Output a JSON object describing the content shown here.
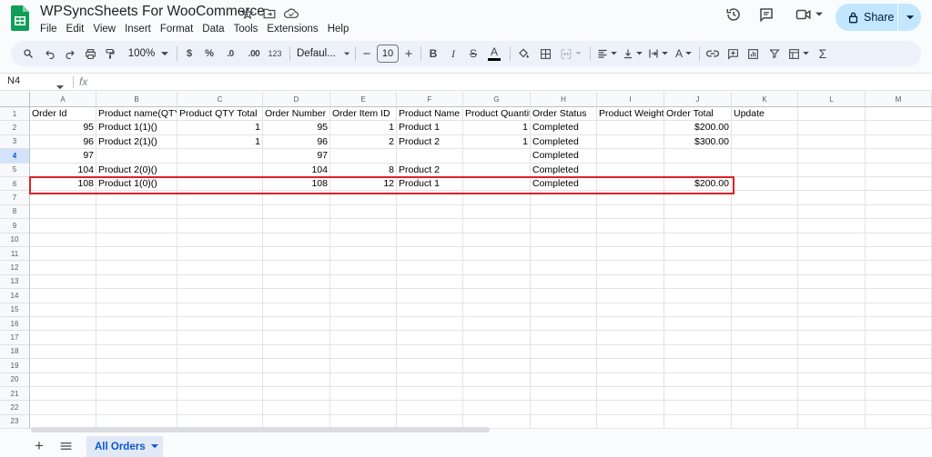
{
  "app": {
    "title": "WPSyncSheets For WooCommerce",
    "menu": [
      "File",
      "Edit",
      "View",
      "Insert",
      "Format",
      "Data",
      "Tools",
      "Extensions",
      "Help"
    ],
    "share_label": "Share",
    "accent_color": "#c2e7ff"
  },
  "toolbar": {
    "zoom": "100%",
    "currency": "$",
    "percent": "%",
    "decrease_decimals": ".0",
    "increase_decimals": ".00",
    "number_format": "123",
    "font": "Defaul...",
    "font_size": "10"
  },
  "formula_bar": {
    "name_box": "N4",
    "fx": "fx"
  },
  "grid": {
    "columns": [
      "A",
      "B",
      "C",
      "D",
      "E",
      "F",
      "G",
      "H",
      "I",
      "J",
      "K",
      "L",
      "M"
    ],
    "row_numbers": [
      "1",
      "2",
      "3",
      "4",
      "5",
      "6",
      "7",
      "8",
      "9",
      "10",
      "11",
      "12",
      "13",
      "14",
      "15",
      "16",
      "17",
      "18",
      "19",
      "20",
      "21",
      "22",
      "23"
    ],
    "active_row": "4",
    "rows": [
      [
        "Order Id",
        "Product name(QTY)",
        "Product QTY Total",
        "Order Number",
        "Order Item ID",
        "Product Name",
        "Product Quantity",
        "Order Status",
        "Product Weight",
        "Order Total",
        "Update",
        "",
        ""
      ],
      [
        "95",
        "Product 1(1)()",
        "1",
        "95",
        "1",
        "Product 1",
        "1",
        "Completed",
        "",
        "$200.00",
        "",
        "",
        ""
      ],
      [
        "96",
        "Product 2(1)()",
        "1",
        "96",
        "2",
        "Product 2",
        "1",
        "Completed",
        "",
        "$300.00",
        "",
        "",
        ""
      ],
      [
        "97",
        "",
        "",
        "97",
        "",
        "",
        "",
        "Completed",
        "",
        "",
        "",
        "",
        ""
      ],
      [
        "104",
        "Product 2(0)()",
        "",
        "104",
        "8",
        "Product 2",
        "",
        "Completed",
        "",
        "",
        "",
        "",
        ""
      ],
      [
        "108",
        "Product 1(0)()",
        "",
        "108",
        "12",
        "Product 1",
        "",
        "Completed",
        "",
        "$200.00",
        "",
        "",
        ""
      ]
    ],
    "highlight_color": "#e0202a"
  },
  "sheets": {
    "active_tab": "All Orders"
  }
}
